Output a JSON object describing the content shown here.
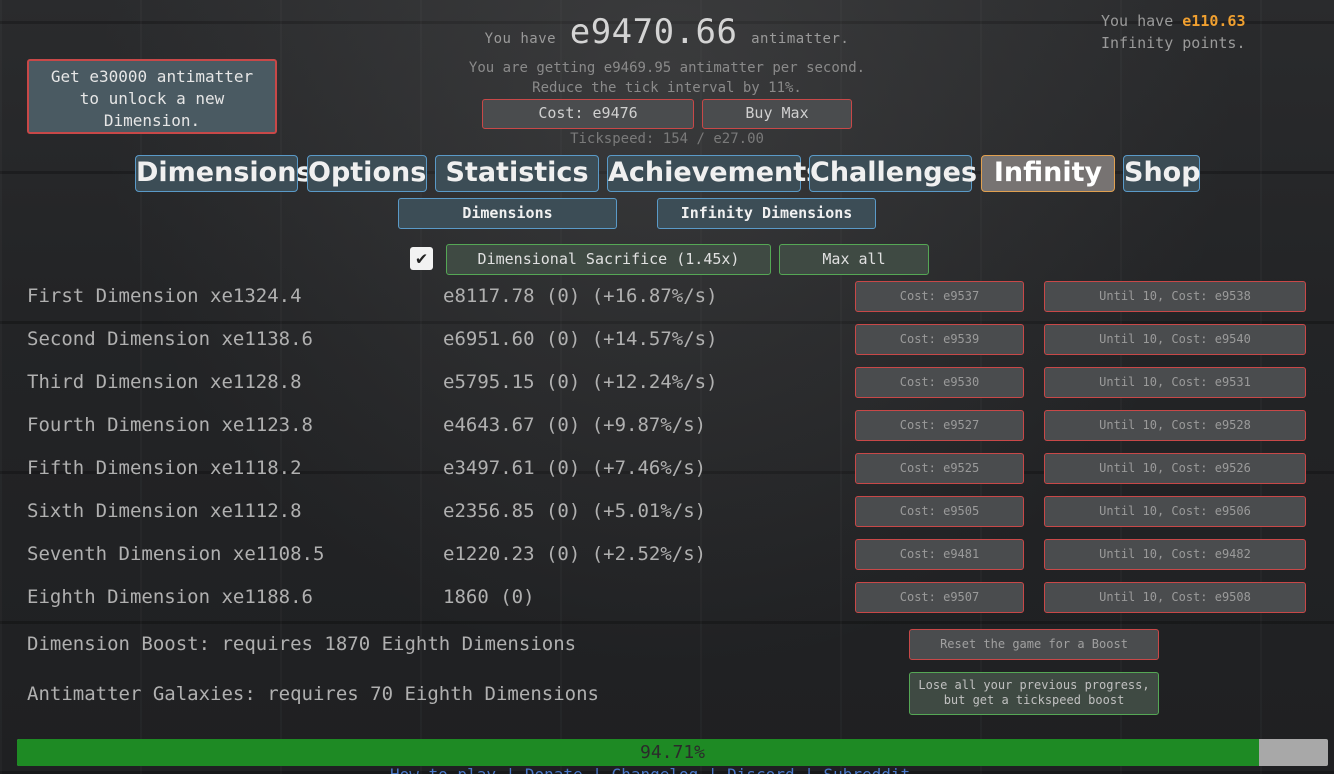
{
  "header": {
    "you_have": "You have",
    "antimatter_amount": "e9470.66",
    "antimatter_word": "antimatter.",
    "rate_text": "You are getting e9469.95 antimatter per second.",
    "tick_desc": "Reduce the tick interval by 11%.",
    "tick_cost": "Cost: e9476",
    "tick_buy_max": "Buy Max",
    "tickspeed": "Tickspeed: 154 / e27.00"
  },
  "infinity_points": {
    "prefix": "You have",
    "value": "e110.63",
    "suffix": "Infinity points."
  },
  "unlock_button": {
    "line1": "Get e30000 antimatter",
    "line2": "to unlock a new",
    "line3": "Dimension."
  },
  "tabs": [
    {
      "label": "Dimensions",
      "active": false
    },
    {
      "label": "Options",
      "active": false
    },
    {
      "label": "Statistics",
      "active": false
    },
    {
      "label": "Achievements",
      "active": false
    },
    {
      "label": "Challenges",
      "active": false
    },
    {
      "label": "Infinity",
      "active": true
    },
    {
      "label": "Shop",
      "active": false
    }
  ],
  "subtabs": [
    {
      "label": "Dimensions"
    },
    {
      "label": "Infinity Dimensions"
    }
  ],
  "sacrifice": {
    "checked": true,
    "check_glyph": "✔",
    "label": "Dimensional Sacrifice (1.45x)",
    "max_all": "Max all"
  },
  "dimensions": [
    {
      "name": "First Dimension xe1324.4",
      "amount": "e8117.78 (0) (+16.87%/s)",
      "cost": "Cost: e9537",
      "until10": "Until 10, Cost: e9538"
    },
    {
      "name": "Second Dimension xe1138.6",
      "amount": "e6951.60 (0) (+14.57%/s)",
      "cost": "Cost: e9539",
      "until10": "Until 10, Cost: e9540"
    },
    {
      "name": "Third Dimension xe1128.8",
      "amount": "e5795.15 (0) (+12.24%/s)",
      "cost": "Cost: e9530",
      "until10": "Until 10, Cost: e9531"
    },
    {
      "name": "Fourth Dimension xe1123.8",
      "amount": "e4643.67 (0) (+9.87%/s)",
      "cost": "Cost: e9527",
      "until10": "Until 10, Cost: e9528"
    },
    {
      "name": "Fifth Dimension xe1118.2",
      "amount": "e3497.61 (0) (+7.46%/s)",
      "cost": "Cost: e9525",
      "until10": "Until 10, Cost: e9526"
    },
    {
      "name": "Sixth Dimension xe1112.8",
      "amount": "e2356.85 (0) (+5.01%/s)",
      "cost": "Cost: e9505",
      "until10": "Until 10, Cost: e9506"
    },
    {
      "name": "Seventh Dimension xe1108.5",
      "amount": "e1220.23 (0) (+2.52%/s)",
      "cost": "Cost: e9481",
      "until10": "Until 10, Cost: e9482"
    },
    {
      "name": "Eighth Dimension xe1188.6",
      "amount": "1860 (0)",
      "cost": "Cost: e9507",
      "until10": "Until 10, Cost: e9508"
    }
  ],
  "boost": {
    "label": "Dimension Boost: requires 1870 Eighth Dimensions",
    "button": "Reset the game for a Boost"
  },
  "galaxy": {
    "label": "Antimatter Galaxies: requires 70 Eighth Dimensions",
    "button_line1": "Lose all your previous progress,",
    "button_line2": "but get a tickspeed boost"
  },
  "progress": {
    "percent": 94.71,
    "label": "94.71%"
  },
  "footer": {
    "text": "How to play | Donate | Changelog | Discord | Subreddit"
  },
  "colors": {
    "ip_orange": "#f0a030",
    "progress_green": "#1e8a24",
    "tab_border_blue": "#5a9ac8",
    "cost_border_red": "#c84848",
    "green_border": "#55a755",
    "active_tab_border": "#e0a050"
  }
}
